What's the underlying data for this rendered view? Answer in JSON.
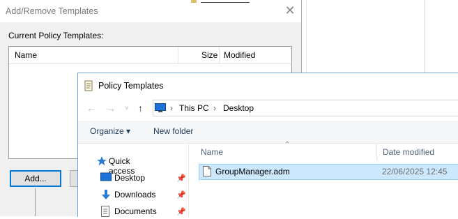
{
  "add_remove": {
    "title": "Add/Remove Templates",
    "close": "✕",
    "current_label": "Current Policy Templates:",
    "columns": [
      "Name",
      "Size",
      "Modified"
    ],
    "add_button": "Add..."
  },
  "policy_templates": {
    "title": "Policy Templates",
    "nav": {
      "back": "←",
      "forward": "→",
      "dropdown": "˅",
      "up": "↑"
    },
    "address": {
      "sep": "›",
      "crumbs": [
        "This PC",
        "Desktop"
      ]
    },
    "toolbar": {
      "organize": "Organize ▾",
      "new_folder": "New folder"
    },
    "nav_items": [
      {
        "label": "Quick access",
        "icon": "star-icon"
      },
      {
        "label": "Desktop",
        "icon": "desktop-icon",
        "pin": "📌"
      },
      {
        "label": "Downloads",
        "icon": "download-icon",
        "pin": "📌"
      },
      {
        "label": "Documents",
        "icon": "document-icon",
        "pin": "📌"
      }
    ],
    "columns": {
      "name": "Name",
      "date": "Date modified"
    },
    "files": [
      {
        "name": "GroupManager.adm",
        "date": "22/06/2025 12:45",
        "selected": true
      }
    ]
  },
  "colors": {
    "accent": "#0078d7",
    "selection": "#cce8ff"
  }
}
